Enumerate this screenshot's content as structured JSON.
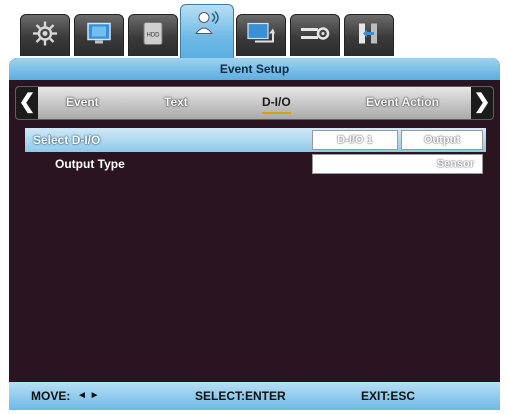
{
  "top_tabs": [
    {
      "icon": "gear-icon"
    },
    {
      "icon": "monitor-icon"
    },
    {
      "icon": "hdd-icon",
      "label": "HDD"
    },
    {
      "icon": "motion-person-icon",
      "active": true
    },
    {
      "icon": "network-icon"
    },
    {
      "icon": "sliders-gear-icon"
    },
    {
      "icon": "exit-door-icon"
    }
  ],
  "window": {
    "title": "Event Setup"
  },
  "subnav": {
    "items": [
      "Event",
      "Text",
      "D-I/O",
      "Event Action"
    ],
    "active": "D-I/O"
  },
  "rows": {
    "select_dio": {
      "label": "Select D-I/O",
      "value": "D-I/O 1",
      "type": "Output"
    },
    "output_type": {
      "label": "Output Type",
      "value": "Sensor"
    }
  },
  "status": {
    "move": "MOVE:",
    "move_arrows": "◄ ►",
    "select": "SELECT:ENTER",
    "exit": "EXIT:ESC"
  },
  "colors": {
    "accent": "#6fb9e6",
    "panel_bg": "#2a1420",
    "underline": "#d7a012"
  }
}
